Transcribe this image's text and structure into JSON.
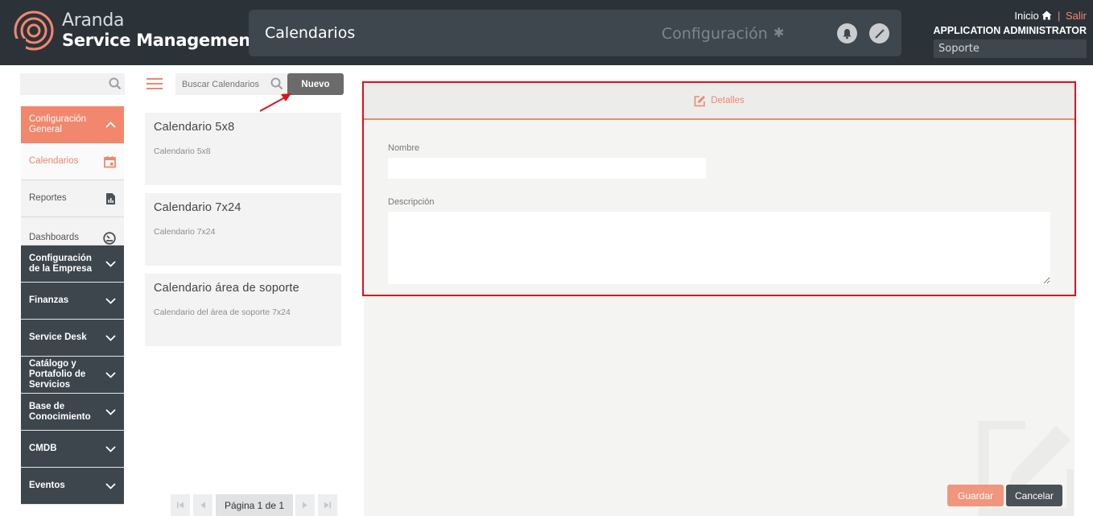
{
  "header": {
    "brand_line1": "Aranda",
    "brand_line2": "Service Management",
    "page_title": "Calendarios",
    "config_label": "Configuración",
    "inicio_label": "Inicio",
    "salir_label": "Salir",
    "user_name": "APPLICATION ADMINISTRATOR",
    "project": "Soporte"
  },
  "sidebar": {
    "search_placeholder": "",
    "items": [
      {
        "label": "Configuración General",
        "icon": "chevron-up-icon",
        "state": "open"
      },
      {
        "label": "Calendarios",
        "icon": "calendar-icon",
        "state": "active"
      },
      {
        "label": "Reportes",
        "icon": "report-file-icon",
        "state": "normal"
      },
      {
        "label": "Dashboards",
        "icon": "gauge-icon",
        "state": "normal"
      },
      {
        "label": "Configuración de la Empresa",
        "icon": "chevron-down-icon",
        "state": "section"
      },
      {
        "label": "Finanzas",
        "icon": "chevron-down-icon",
        "state": "section"
      },
      {
        "label": "Service Desk",
        "icon": "chevron-down-icon",
        "state": "section"
      },
      {
        "label": "Catálogo y Portafolio de Servicios",
        "icon": "chevron-down-icon",
        "state": "section"
      },
      {
        "label": "Base de Conocimiento",
        "icon": "chevron-down-icon",
        "state": "section"
      },
      {
        "label": "CMDB",
        "icon": "chevron-down-icon",
        "state": "section"
      },
      {
        "label": "Eventos",
        "icon": "chevron-down-icon",
        "state": "section"
      }
    ]
  },
  "list": {
    "search_placeholder": "Buscar Calendarios",
    "new_button": "Nuevo",
    "cards": [
      {
        "title": "Calendario 5x8",
        "description": "Calendario 5x8"
      },
      {
        "title": "Calendario 7x24",
        "description": "Calendario 7x24"
      },
      {
        "title": "Calendario área de soporte",
        "description": "Calendario del área de soporte 7x24"
      }
    ],
    "pager_label": "Página 1 de 1"
  },
  "detail": {
    "tab_label": "Detalles",
    "name_label": "Nombre",
    "name_value": "",
    "description_label": "Descripción",
    "description_value": "",
    "save_button": "Guardar",
    "cancel_button": "Cancelar"
  },
  "colors": {
    "accent": "#f2876d",
    "dark": "#2b3339",
    "highlight_frame": "#e0101a"
  }
}
